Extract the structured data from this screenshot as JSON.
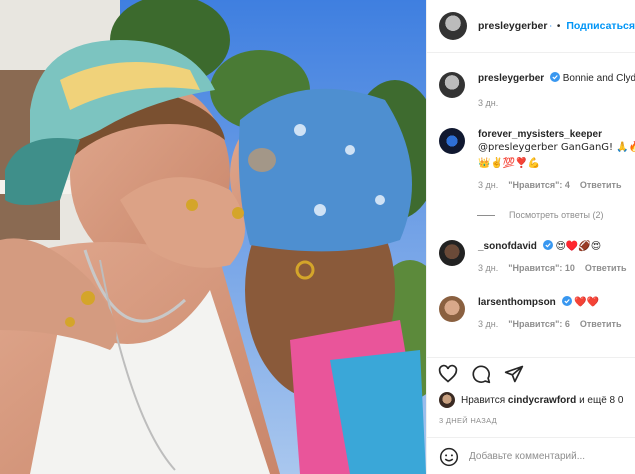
{
  "post": {
    "author": "presleygerber",
    "follow_label": "Подписаться",
    "more_label": "•",
    "caption_text": "Bonnie and Clyde",
    "caption_time": "3 дн."
  },
  "comments": [
    {
      "username": "forever_mysisters_keeper",
      "text_line1": "@presleygerber GanGanG! 🙏🔥",
      "text_line2": "👑✌️💯❣️💪",
      "time": "3 дн.",
      "likes": "\"Нравится\": 4",
      "reply": "Ответить",
      "view_replies": "Посмотреть ответы (2)"
    },
    {
      "username": "_sonofdavid",
      "text": "😍♥️🏈😍",
      "time": "3 дн.",
      "likes": "\"Нравится\": 10",
      "reply": "Ответить"
    },
    {
      "username": "larsenthompson",
      "text": "❤️❤️",
      "time": "3 дн.",
      "likes": "\"Нравится\": 6",
      "reply": "Ответить"
    }
  ],
  "likes_line": {
    "prefix": "Нравится",
    "user": "cindycrawford",
    "suffix": "и ещё 8 0"
  },
  "posted_ago": "3 ДНЕЙ НАЗАД",
  "add_comment_placeholder": "Добавьте комментарий..."
}
